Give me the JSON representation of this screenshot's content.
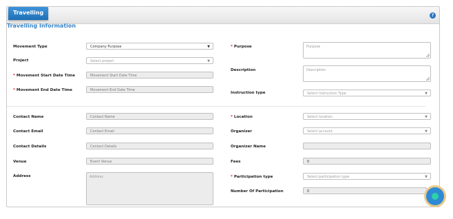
{
  "header": {
    "tab_label": "Travelling",
    "help_glyph": "?"
  },
  "section_title": "Travelling Information",
  "left_top": {
    "movement_type_label": "Movement Type",
    "movement_type_value": "Company Purpose",
    "project_label": "Project",
    "project_placeholder": "Select project",
    "start_label": "Movement Start Date Time",
    "start_placeholder": "Movement Start Date Time",
    "end_label": "Movement End Date Time",
    "end_placeholder": "Movement End Date Time"
  },
  "right_top": {
    "purpose_label": "Purpose",
    "purpose_placeholder": "Purpose",
    "description_label": "Description",
    "description_placeholder": "Description",
    "instruction_label": "Instruction type",
    "instruction_placeholder": "Select Instruction Type"
  },
  "left_bottom": {
    "contact_name_label": "Contact Name",
    "contact_name_placeholder": "Contact Name",
    "contact_email_label": "Contact Email",
    "contact_email_placeholder": "Contact Email",
    "contact_details_label": "Contact Details",
    "contact_details_placeholder": "Contact Details",
    "venue_label": "Venue",
    "venue_placeholder": "Event Venue",
    "address_label": "Address",
    "address_placeholder": "Address"
  },
  "right_bottom": {
    "location_label": "Location",
    "location_placeholder": "Select location",
    "organizer_label": "Organizer",
    "organizer_placeholder": "Select account",
    "organizer_name_label": "Organizer Name",
    "organizer_name_value": "",
    "fees_label": "Fees",
    "fees_value": "0",
    "participation_type_label": "Participation type",
    "participation_type_placeholder": "Select participation type",
    "participation_count_label": "Number Of Participation",
    "participation_count_value": "0"
  },
  "required_marker": "*",
  "colors": {
    "accent": "#3a86c8",
    "tab": "#1e6fb6",
    "required": "#d9232d",
    "chat": "#2f8ad6"
  }
}
